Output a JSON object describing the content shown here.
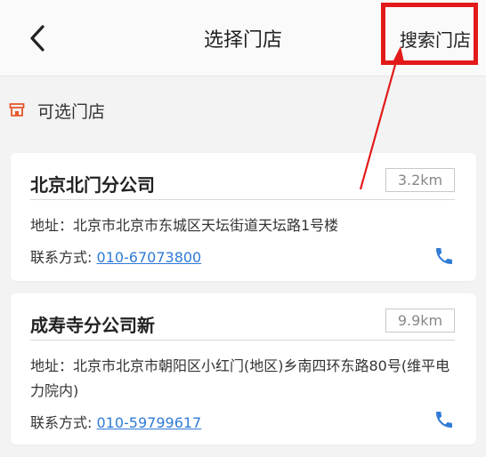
{
  "header": {
    "title": "选择门店",
    "search_label": "搜索门店"
  },
  "section": {
    "label": "可选门店"
  },
  "stores": [
    {
      "name": "北京北门分公司",
      "distance": "3.2km",
      "address": "地址：北京市北京市东城区天坛街道天坛路1号楼",
      "contact_label": "联系方式: ",
      "phone": "010-67073800"
    },
    {
      "name": "成寿寺分公司新",
      "distance": "9.9km",
      "address": "地址：北京市北京市朝阳区小红门(地区)乡南四环东路80号(维平电力院内)",
      "contact_label": "联系方式: ",
      "phone": "010-59799617"
    }
  ],
  "colors": {
    "accent": "#2f7bd6",
    "highlight": "#e21a1a",
    "store_icon": "#e8562c"
  },
  "icons": {
    "back": "back-arrow-icon",
    "store": "store-icon",
    "phone": "phone-icon"
  }
}
